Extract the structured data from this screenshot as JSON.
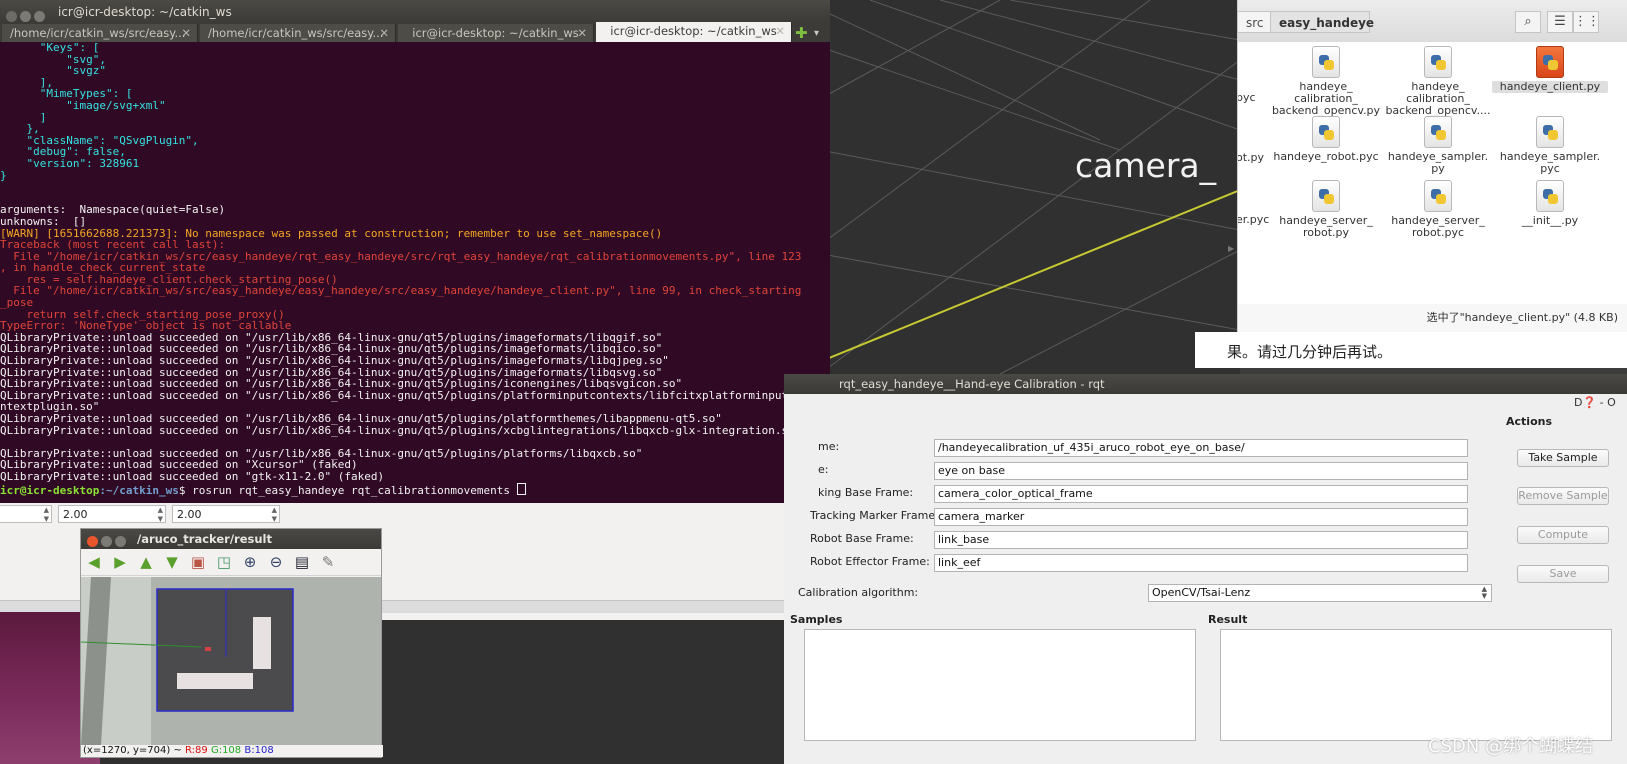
{
  "rviz": {
    "frame_label": "camera_"
  },
  "background_panel": {
    "spin_values": [
      "",
      "2.00",
      "2.00"
    ]
  },
  "terminal": {
    "title": "icr@icr-desktop: ~/catkin_ws",
    "tabs": [
      "/home/icr/catkin_ws/src/easy...",
      "/home/icr/catkin_ws/src/easy...",
      "icr@icr-desktop: ~/catkin_ws",
      "icr@icr-desktop: ~/catkin_ws"
    ],
    "lines": [
      {
        "t": "      \"Keys\": [",
        "c": "cyan"
      },
      {
        "t": "          \"svg\",",
        "c": "cyan"
      },
      {
        "t": "          \"svgz\"",
        "c": "cyan"
      },
      {
        "t": "      ],",
        "c": "cyan"
      },
      {
        "t": "      \"MimeTypes\": [",
        "c": "cyan"
      },
      {
        "t": "          \"image/svg+xml\"",
        "c": "cyan"
      },
      {
        "t": "      ]",
        "c": "cyan"
      },
      {
        "t": "    },",
        "c": "cyan"
      },
      {
        "t": "    \"className\": \"QSvgPlugin\",",
        "c": "cyan"
      },
      {
        "t": "    \"debug\": false,",
        "c": "cyan"
      },
      {
        "t": "    \"version\": 328961",
        "c": "cyan"
      },
      {
        "t": "}",
        "c": "cyan"
      },
      {
        "t": "",
        "c": "white"
      },
      {
        "t": "",
        "c": "white"
      },
      {
        "t": "arguments:  Namespace(quiet=False)",
        "c": "white"
      },
      {
        "t": "unknowns:  []",
        "c": "white"
      },
      {
        "t": "[WARN] [1651662688.221373]: No namespace was passed at construction; remember to use set_namespace()",
        "c": "warn"
      },
      {
        "t": "Traceback (most recent call last):",
        "c": "red"
      },
      {
        "t": "  File \"/home/icr/catkin_ws/src/easy_handeye/rqt_easy_handeye/src/rqt_easy_handeye/rqt_calibrationmovements.py\", line 123",
        "c": "red"
      },
      {
        "t": ", in handle_check_current_state",
        "c": "red"
      },
      {
        "t": "    res = self.handeye_client.check_starting_pose()",
        "c": "red"
      },
      {
        "t": "  File \"/home/icr/catkin_ws/src/easy_handeye/easy_handeye/src/easy_handeye/handeye_client.py\", line 99, in check_starting",
        "c": "red"
      },
      {
        "t": "_pose",
        "c": "red"
      },
      {
        "t": "    return self.check_starting_pose_proxy()",
        "c": "red"
      },
      {
        "t": "TypeError: 'NoneType' object is not callable",
        "c": "red"
      },
      {
        "t": "QLibraryPrivate::unload succeeded on \"/usr/lib/x86_64-linux-gnu/qt5/plugins/imageformats/libqgif.so\"",
        "c": "white"
      },
      {
        "t": "QLibraryPrivate::unload succeeded on \"/usr/lib/x86_64-linux-gnu/qt5/plugins/imageformats/libqico.so\"",
        "c": "white"
      },
      {
        "t": "QLibraryPrivate::unload succeeded on \"/usr/lib/x86_64-linux-gnu/qt5/plugins/imageformats/libqjpeg.so\"",
        "c": "white"
      },
      {
        "t": "QLibraryPrivate::unload succeeded on \"/usr/lib/x86_64-linux-gnu/qt5/plugins/imageformats/libqsvg.so\"",
        "c": "white"
      },
      {
        "t": "QLibraryPrivate::unload succeeded on \"/usr/lib/x86_64-linux-gnu/qt5/plugins/iconengines/libqsvgicon.so\"",
        "c": "white"
      },
      {
        "t": "QLibraryPrivate::unload succeeded on \"/usr/lib/x86_64-linux-gnu/qt5/plugins/platforminputcontexts/libfcitxplatforminputco",
        "c": "white"
      },
      {
        "t": "ntextplugin.so\"",
        "c": "white"
      },
      {
        "t": "QLibraryPrivate::unload succeeded on \"/usr/lib/x86_64-linux-gnu/qt5/plugins/platformthemes/libappmenu-qt5.so\"",
        "c": "white"
      },
      {
        "t": "QLibraryPrivate::unload succeeded on \"/usr/lib/x86_64-linux-gnu/qt5/plugins/xcbglintegrations/libqxcb-glx-integration.so\"",
        "c": "white"
      },
      {
        "t": "",
        "c": "white"
      },
      {
        "t": "QLibraryPrivate::unload succeeded on \"/usr/lib/x86_64-linux-gnu/qt5/plugins/platforms/libqxcb.so\"",
        "c": "white"
      },
      {
        "t": "QLibraryPrivate::unload succeeded on \"Xcursor\" (faked)",
        "c": "white"
      },
      {
        "t": "QLibraryPrivate::unload succeeded on \"gtk-x11-2.0\" (faked)",
        "c": "white"
      }
    ],
    "prompt_user": "icr@icr-desktop",
    "prompt_path": ":~/catkin_ws",
    "prompt_command": "$ rosrun rqt_easy_handeye rqt_calibrationmovements "
  },
  "file_manager": {
    "breadcrumbs": [
      "src",
      "easy_handeye"
    ],
    "items": [
      {
        "label": "handeye_\ncalibration_\nbackend_opencv.py",
        "selected": false
      },
      {
        "label": "handeye_\ncalibration_\nbackend_opencv....",
        "selected": false
      },
      {
        "label": "handeye_client.py",
        "selected": true
      },
      {
        "label": "handeye_robot.pyc",
        "selected": false
      },
      {
        "label": "handeye_sampler.\npy",
        "selected": false
      },
      {
        "label": "handeye_sampler.\npyc",
        "selected": false
      },
      {
        "label": "handeye_server_\nrobot.py",
        "selected": false
      },
      {
        "label": "handeye_server_\nrobot.pyc",
        "selected": false
      },
      {
        "label": "__init__.py",
        "selected": false
      }
    ],
    "cut_items": [
      "pyc",
      "ot.py",
      "er.pyc"
    ],
    "status": "选中了\"handeye_client.py\" (4.8 KB)"
  },
  "notice_text": "果。请过几分钟后再试。",
  "aruco_window": {
    "title": "/aruco_tracker/result",
    "status_prefix": "(x=1270, y=704) ~ ",
    "r": "R:89",
    "g": "G:108",
    "b": "B:108"
  },
  "rqt": {
    "title": "rqt_easy_handeye__Hand-eye Calibration - rqt",
    "top_icons": "D❓ - O",
    "fields": [
      {
        "label": "me:",
        "value": "/handeyecalibration_uf_435i_aruco_robot_eye_on_base/"
      },
      {
        "label": "e:",
        "value": "eye on base"
      },
      {
        "label": "king Base Frame:",
        "value": "camera_color_optical_frame"
      },
      {
        "label": "Tracking Marker Frame:",
        "value": "camera_marker"
      },
      {
        "label": "Robot Base Frame:",
        "value": "link_base"
      },
      {
        "label": "Robot Effector Frame:",
        "value": "link_eef"
      }
    ],
    "calibration_algorithm_label": "Calibration algorithm:",
    "calibration_algorithm_value": "OpenCV/Tsai-Lenz",
    "actions_header": "Actions",
    "buttons": {
      "take_sample": "Take Sample",
      "remove_sample": "Remove Sample",
      "compute": "Compute",
      "save": "Save"
    },
    "samples_header": "Samples",
    "result_header": "Result"
  },
  "watermark": "CSDN @绑个蝴蝶结"
}
